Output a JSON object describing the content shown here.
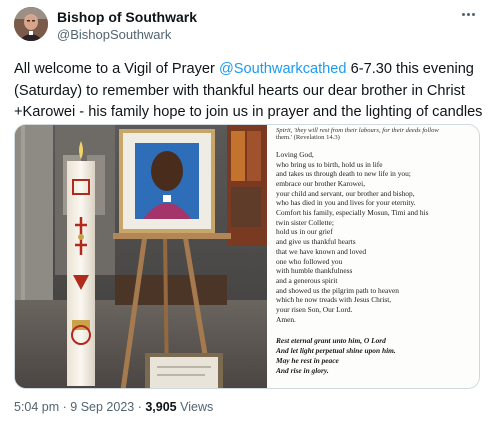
{
  "author": {
    "name": "Bishop of Southwark",
    "handle": "@BishopSouthwark"
  },
  "tweet": {
    "text_before": "All welcome to a Vigil of Prayer ",
    "mention": "@Southwarkcathed",
    "text_after": " 6-7.30 this evening (Saturday) to remember with thankful hearts our dear brother in Christ +Karowei - his family hope to join us in prayer and the lighting of candles"
  },
  "media": {
    "doc_header_line1": "Spirit, 'they will rest from their labours, for their deeds follow",
    "doc_header_line2": "them.' (Revelation 14.3)",
    "prayer_lines": [
      "Loving God,",
      "who bring us to birth, hold us in life",
      "and takes us through death to new life in you;",
      "embrace our brother Karowei,",
      "your child and servant, our brother and bishop,",
      "who has died in you and lives for your eternity.",
      "Comfort his family, especially Mosun, Timi and his",
      "twin sister Collette;",
      "hold us in our grief",
      "and give us thankful hearts",
      "that we have known and loved",
      "one who followed you",
      "with humble thankfulness",
      "and a generous spirit",
      "and showed us the pilgrim path to heaven",
      "which he now treads with Jesus Christ,",
      "your risen Son, Our Lord.",
      "Amen."
    ],
    "rest_lines": [
      "Rest eternal grant unto him, O Lord",
      "And let light perpetual shine upon him.",
      "May he rest in peace",
      "And rise in glory."
    ]
  },
  "meta": {
    "time": "5:04 pm",
    "separator": " · ",
    "date": "9 Sep 2023",
    "views_count": "3,905",
    "views_label": " Views"
  },
  "colors": {
    "accent": "#1d9bf0",
    "secondary_text": "#536471"
  }
}
